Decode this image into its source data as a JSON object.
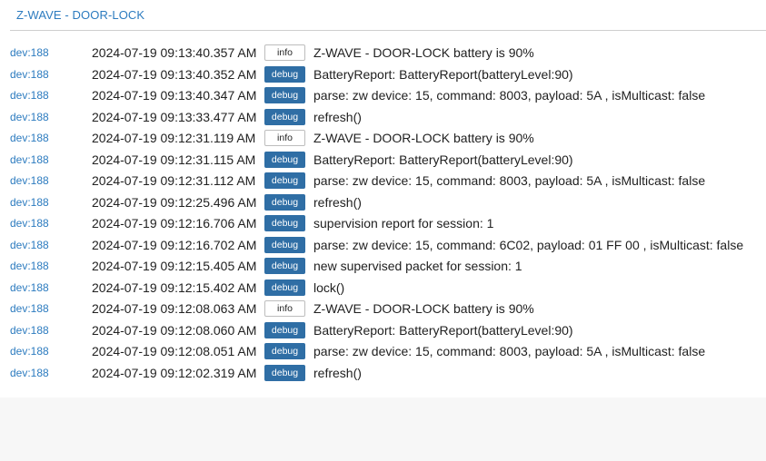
{
  "device": {
    "title": "Z-WAVE - DOOR-LOCK"
  },
  "logs": [
    {
      "dev": "dev:188",
      "time": "2024-07-19 09:13:40.357 AM",
      "level": "info",
      "message": "Z-WAVE - DOOR-LOCK battery is 90%"
    },
    {
      "dev": "dev:188",
      "time": "2024-07-19 09:13:40.352 AM",
      "level": "debug",
      "message": "BatteryReport: BatteryReport(batteryLevel:90)"
    },
    {
      "dev": "dev:188",
      "time": "2024-07-19 09:13:40.347 AM",
      "level": "debug",
      "message": "parse: zw device: 15, command: 8003, payload: 5A , isMulticast: false"
    },
    {
      "dev": "dev:188",
      "time": "2024-07-19 09:13:33.477 AM",
      "level": "debug",
      "message": "refresh()"
    },
    {
      "dev": "dev:188",
      "time": "2024-07-19 09:12:31.119 AM",
      "level": "info",
      "message": "Z-WAVE - DOOR-LOCK battery is 90%"
    },
    {
      "dev": "dev:188",
      "time": "2024-07-19 09:12:31.115 AM",
      "level": "debug",
      "message": "BatteryReport: BatteryReport(batteryLevel:90)"
    },
    {
      "dev": "dev:188",
      "time": "2024-07-19 09:12:31.112 AM",
      "level": "debug",
      "message": "parse: zw device: 15, command: 8003, payload: 5A , isMulticast: false"
    },
    {
      "dev": "dev:188",
      "time": "2024-07-19 09:12:25.496 AM",
      "level": "debug",
      "message": "refresh()"
    },
    {
      "dev": "dev:188",
      "time": "2024-07-19 09:12:16.706 AM",
      "level": "debug",
      "message": "supervision report for session: 1"
    },
    {
      "dev": "dev:188",
      "time": "2024-07-19 09:12:16.702 AM",
      "level": "debug",
      "message": "parse: zw device: 15, command: 6C02, payload: 01 FF 00 , isMulticast: false"
    },
    {
      "dev": "dev:188",
      "time": "2024-07-19 09:12:15.405 AM",
      "level": "debug",
      "message": "new supervised packet for session: 1"
    },
    {
      "dev": "dev:188",
      "time": "2024-07-19 09:12:15.402 AM",
      "level": "debug",
      "message": "lock()"
    },
    {
      "dev": "dev:188",
      "time": "2024-07-19 09:12:08.063 AM",
      "level": "info",
      "message": "Z-WAVE - DOOR-LOCK battery is 90%"
    },
    {
      "dev": "dev:188",
      "time": "2024-07-19 09:12:08.060 AM",
      "level": "debug",
      "message": "BatteryReport: BatteryReport(batteryLevel:90)"
    },
    {
      "dev": "dev:188",
      "time": "2024-07-19 09:12:08.051 AM",
      "level": "debug",
      "message": "parse: zw device: 15, command: 8003, payload: 5A , isMulticast: false"
    },
    {
      "dev": "dev:188",
      "time": "2024-07-19 09:12:02.319 AM",
      "level": "debug",
      "message": "refresh()"
    }
  ],
  "colors": {
    "link": "#2c7bbf",
    "debug_badge": "#2f6ea5",
    "info_badge": "#ffffff"
  }
}
